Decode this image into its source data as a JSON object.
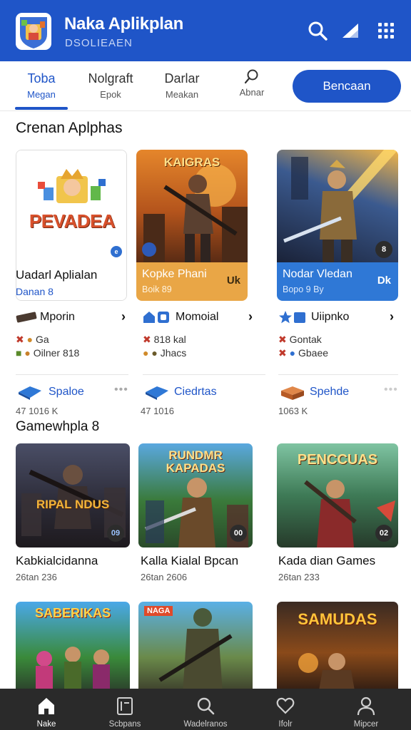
{
  "header": {
    "title": "Naka Aplikplan",
    "subtitle": "DSOLIEAEN",
    "icons": [
      "search-icon",
      "signal-icon",
      "grid-menu-icon"
    ]
  },
  "tabs": [
    {
      "label": "Toba",
      "sub": "Megan",
      "active": true
    },
    {
      "label": "Nolgraft",
      "sub": "Epok",
      "active": false
    },
    {
      "label": "Darlar",
      "sub": "Meakan",
      "active": false
    },
    {
      "label": "",
      "sub": "Abnar",
      "icon": "search-icon",
      "active": false
    }
  ],
  "cta": {
    "label": "Bencaan"
  },
  "featured": {
    "title": "Crenan Aplphas",
    "cards": [
      {
        "logo_text": "PEVADEA",
        "name": "Uadarl Aplialan",
        "sub": "Danan 8",
        "badge": "e"
      },
      {
        "art_text": "KAIGRAS",
        "name": "Kopke Phani",
        "sub": "Boik 89",
        "tag": "Uk"
      },
      {
        "name": "Nodar Vledan",
        "sub": "Bopo 9 By",
        "tag": "Dk",
        "badge": "8"
      }
    ],
    "features": [
      {
        "label": "Mporin",
        "icon": "joystick-icon",
        "meta1": "Ga",
        "meta2": "Oilner 818"
      },
      {
        "label": "Momoial",
        "icon": "home-icon",
        "meta1": "818 kal",
        "meta2": "Jhacs"
      },
      {
        "label": "Uiipnko",
        "icon": "star-icon",
        "meta1": "Gontak",
        "meta2": "Gbaee"
      }
    ],
    "categories": [
      {
        "label": "Spaloe",
        "count": "47 1016 K"
      },
      {
        "label": "Ciedrtas",
        "count": "47 1016"
      },
      {
        "label": "Spehde",
        "count": "1063 K"
      }
    ]
  },
  "games": {
    "title": "Gamewhpla 8",
    "items": [
      {
        "art_text": "RIPAL NDUS",
        "badge": "09",
        "name": "Kabkialcidanna",
        "sub": "26tan 236"
      },
      {
        "art_text": "RUNDMR KAPADAS",
        "badge": "00",
        "name": "Kalla Kialal Bpcan",
        "sub": "26tan 2606"
      },
      {
        "art_text": "PENCCUAS",
        "badge": "02",
        "name": "Kada dian Games",
        "sub": "26tan 233"
      },
      {
        "art_text": "SABERIKAS",
        "badge": "",
        "name": "",
        "sub": ""
      },
      {
        "art_text": "NAGA",
        "badge": "",
        "name": "",
        "sub": ""
      },
      {
        "art_text": "SAMUDAS",
        "badge": "",
        "name": "",
        "sub": ""
      }
    ]
  },
  "bottom_nav": [
    {
      "label": "Nake",
      "icon": "home-icon",
      "active": true
    },
    {
      "label": "Scbpans",
      "icon": "book-icon",
      "active": false
    },
    {
      "label": "Wadelranos",
      "icon": "search-icon",
      "active": false
    },
    {
      "label": "Ifolr",
      "icon": "heart-icon",
      "active": false
    },
    {
      "label": "Mipcer",
      "icon": "profile-icon",
      "active": false
    }
  ],
  "colors": {
    "primary": "#1f55c8",
    "accent_orange": "#e9a646",
    "accent_blue": "#2f78d6"
  }
}
